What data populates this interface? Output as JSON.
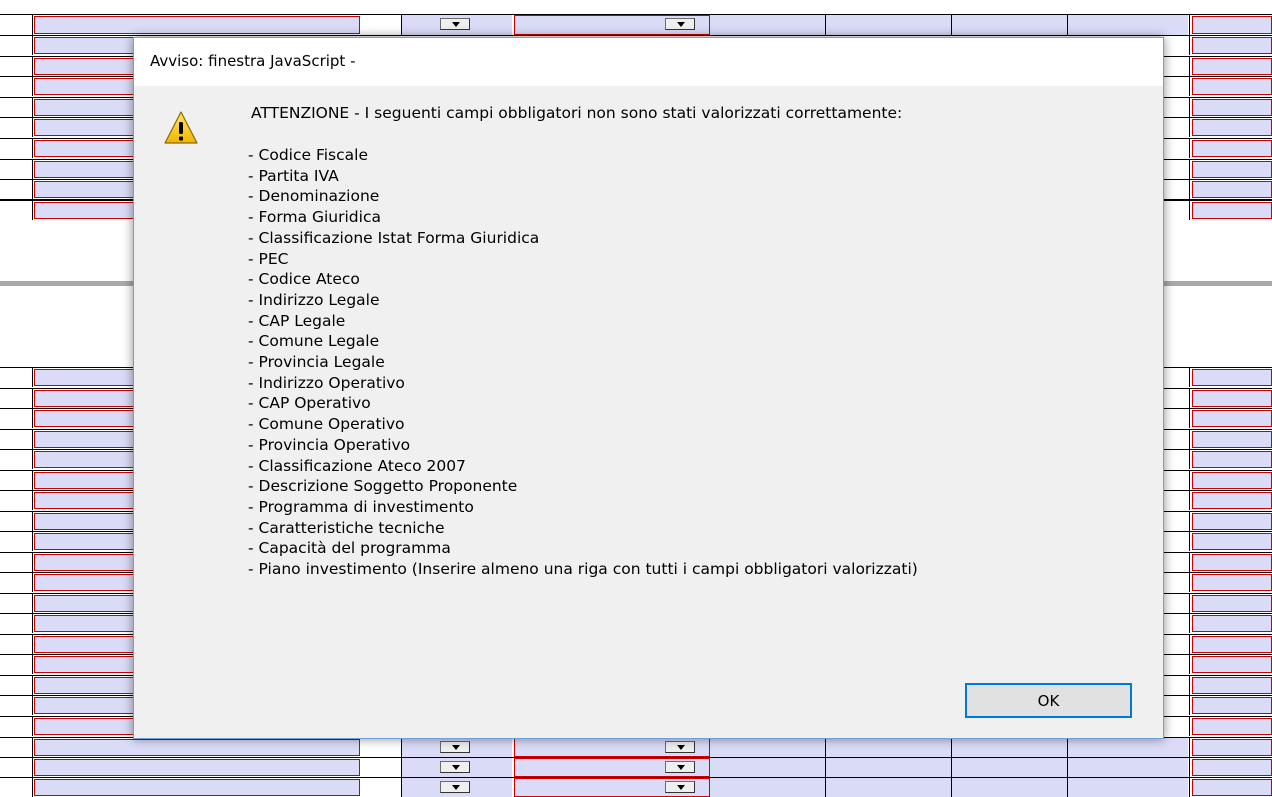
{
  "dialog": {
    "title": "Avviso: finestra JavaScript -",
    "icon": "warning-icon",
    "heading": "ATTENZIONE - I seguenti campi obbligatori non sono stati valorizzati correttamente:",
    "items": [
      "- Codice Fiscale",
      "- Partita IVA",
      "- Denominazione",
      "- Forma Giuridica",
      "- Classificazione Istat Forma Giuridica",
      "- PEC",
      "- Codice Ateco",
      "- Indirizzo Legale",
      "- CAP Legale",
      "- Comune Legale",
      "- Provincia Legale",
      "- Indirizzo Operativo",
      "- CAP Operativo",
      "- Comune Operativo",
      "- Provincia Operativo",
      "- Classificazione Ateco 2007",
      "- Descrizione Soggetto Proponente",
      "- Programma di investimento",
      "- Caratteristiche tecniche",
      "- Capacità del programma",
      "- Piano investimento (Inserire almeno una riga con tutti i campi obbligatori valorizzati)"
    ],
    "ok_label": "OK"
  },
  "colors": {
    "field_fill": "#dadbf7",
    "required_border": "#cc0000",
    "dialog_bg": "#f0f0f0",
    "ok_focus_border": "#0078d7"
  }
}
